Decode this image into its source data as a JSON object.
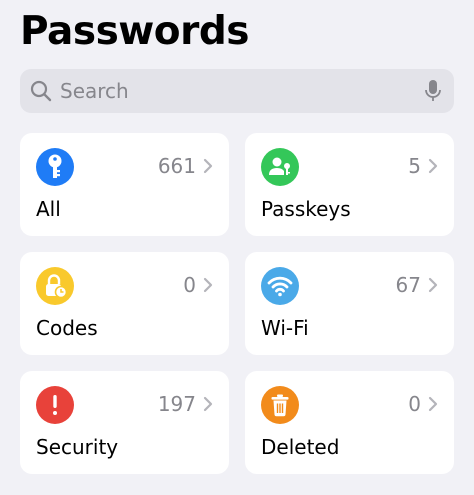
{
  "header": {
    "title": "Passwords"
  },
  "search": {
    "placeholder": "Search",
    "value": ""
  },
  "categories": [
    {
      "label": "All",
      "count": "661",
      "icon": "key-icon",
      "color": "#1f7cf6"
    },
    {
      "label": "Passkeys",
      "count": "5",
      "icon": "passkey-icon",
      "color": "#34c759"
    },
    {
      "label": "Codes",
      "count": "0",
      "icon": "code-lock-icon",
      "color": "#f9c92c"
    },
    {
      "label": "Wi-Fi",
      "count": "67",
      "icon": "wifi-icon",
      "color": "#4aa9e8"
    },
    {
      "label": "Security",
      "count": "197",
      "icon": "exclamation-icon",
      "color": "#e8423a"
    },
    {
      "label": "Deleted",
      "count": "0",
      "icon": "trash-icon",
      "color": "#f28b1b"
    }
  ]
}
